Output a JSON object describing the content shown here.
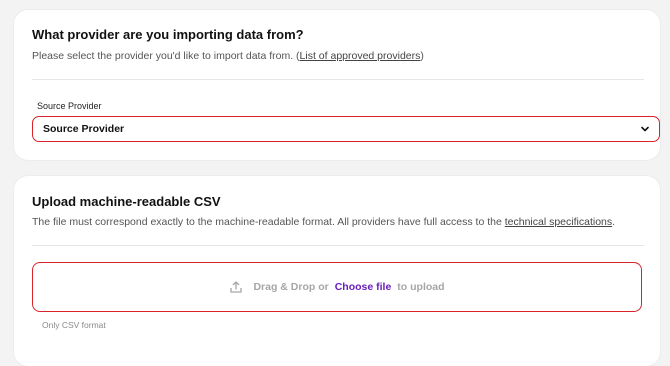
{
  "provider_section": {
    "title": "What provider are you importing data from?",
    "description_prefix": "Please select the provider you'd like to import data from. (",
    "description_link": "List of approved providers",
    "description_suffix": ")",
    "field_label": "Source Provider",
    "select_value": "Source Provider",
    "select_icon": "chevron-down-icon"
  },
  "upload_section": {
    "title": "Upload machine-readable CSV",
    "description_prefix": "The file must correspond exactly to the machine-readable format. All providers have full access to the ",
    "description_link": "technical specifications",
    "description_suffix": ".",
    "dropzone_text_before": "Drag & Drop or",
    "dropzone_link": "Choose file",
    "dropzone_text_after": "to upload",
    "dropzone_icon": "upload-icon",
    "hint": "Only CSV format"
  },
  "colors": {
    "error_border": "#d9232a",
    "link_accent": "#6a1fb8"
  }
}
